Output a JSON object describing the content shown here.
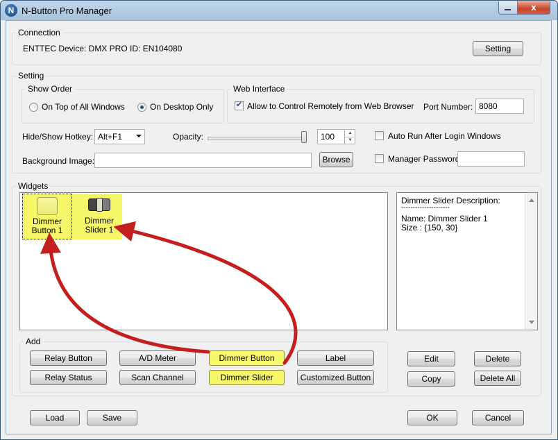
{
  "window": {
    "title": "N-Button Pro Manager",
    "icon_letter": "N",
    "minimize_icon": "minimize-icon",
    "close_glyph": "x"
  },
  "connection": {
    "group_title": "Connection",
    "device_text": "ENTTEC Device: DMX PRO ID: EN104080",
    "setting_button": "Setting"
  },
  "setting": {
    "group_title": "Setting",
    "show_order": {
      "title": "Show Order",
      "options": [
        {
          "label": "On Top of All Windows",
          "selected": false
        },
        {
          "label": "On Desktop Only",
          "selected": true
        }
      ]
    },
    "web_interface": {
      "title": "Web Interface",
      "allow_remote_label": "Allow to Control Remotely from Web Browser",
      "allow_remote_checked": true,
      "port_label": "Port Number:",
      "port_value": "8080"
    },
    "hotkey_label": "Hide/Show Hotkey:",
    "hotkey_value": "Alt+F1",
    "opacity_label": "Opacity:",
    "opacity_value": "100",
    "opacity_fraction": 1.0,
    "auto_run_label": "Auto Run After Login Windows",
    "auto_run_checked": false,
    "background_label": "Background Image:",
    "background_value": "",
    "browse_button": "Browse",
    "manager_password_label": "Manager Password",
    "manager_password_checked": false,
    "manager_password_value": ""
  },
  "widgets": {
    "group_title": "Widgets",
    "items": [
      {
        "line1": "Dimmer",
        "line2": "Button 1"
      },
      {
        "line1": "Dimmer",
        "line2": "Slider 1"
      }
    ],
    "description": {
      "title": "Dimmer Slider Description:",
      "separator": "---------------------",
      "name_line": "Name: Dimmer Slider 1",
      "size_line": "Size : {150, 30}"
    }
  },
  "add": {
    "group_title": "Add",
    "buttons": [
      "Relay Button",
      "A/D Meter",
      "Dimmer Button",
      "Label",
      "Relay Status",
      "Scan Channel",
      "Dimmer Slider",
      "Customized Button"
    ]
  },
  "side_buttons": {
    "edit": "Edit",
    "delete": "Delete",
    "copy": "Copy",
    "delete_all": "Delete All"
  },
  "bottom_buttons": {
    "load": "Load",
    "save": "Save",
    "ok": "OK",
    "cancel": "Cancel"
  },
  "colors": {
    "highlight": "#f7f76a",
    "arrow": "#c41e1e"
  }
}
